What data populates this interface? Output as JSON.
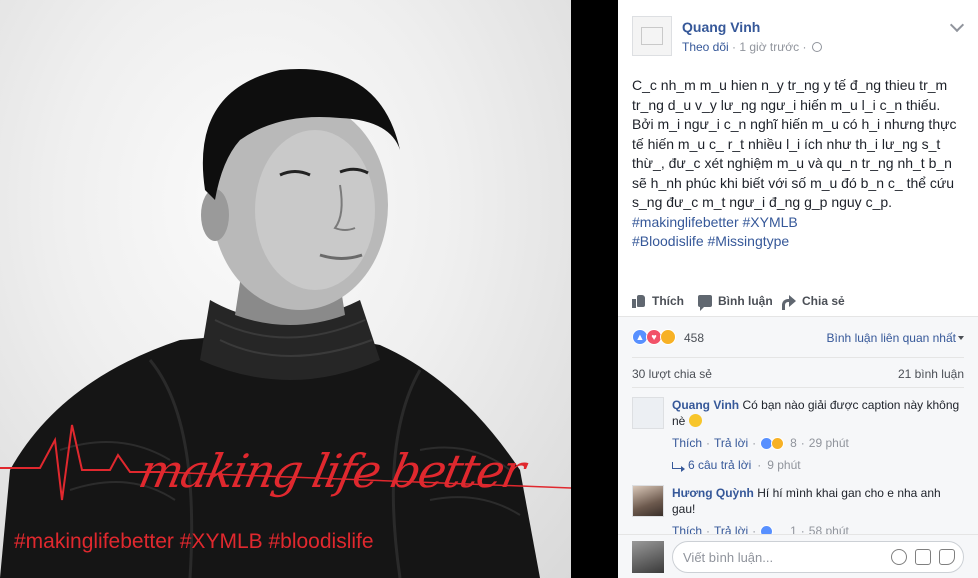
{
  "photo": {
    "overlay_script": "making life better",
    "overlay_tags": "#makinglifebetter #XYMLB #bloodislife",
    "accent_color": "#e0282e"
  },
  "post": {
    "author": "Quang Vinh",
    "follow_label": "Theo dõi",
    "meta_sep": " · ",
    "time": "1 giờ trước",
    "meta_sep2": " · ",
    "caption_lines": [
      "C_c nh_m m_u hien n_y tr_ng y tế đ_ng thieu tr_m tr_ng d_u v_y lư_ng ngư_i hiến m_u l_i c_n thiếu.",
      "Bởi m_i ngư_i c_n nghĩ hiến m_u có h_i nhưng thực tế hiến m_u c_ r_t nhiều l_i ích như th_i lư_ng s_t thừ_, đư_c xét nghiệm m_u và qu_n tr_ng nh_t b_n sẽ h_nh phúc khi biết với số m_u đó b_n c_ thể cứu s_ng đư_c m_t ngư_i đ_ng g_p nguy c_p."
    ],
    "hashtags_line1": [
      "#makinglifebetter",
      "#XYMLB"
    ],
    "hashtags_line2": [
      "#Bloodislife",
      "#Missingtype"
    ]
  },
  "actions": {
    "like": "Thích",
    "comment": "Bình luận",
    "share": "Chia sẻ"
  },
  "feedback": {
    "reaction_count": "458",
    "sort_label": "Bình luận liên quan nhất",
    "shares": "30 lượt chia sẻ",
    "comments_count": "21 bình luận"
  },
  "comments": [
    {
      "name": "Quang Vinh",
      "text": "Có bạn nào giải được caption này không nè",
      "like": "Thích",
      "reply": "Trả lời",
      "reaction_count": "8",
      "time": "29 phút",
      "replies_label": "6 câu trả lời",
      "replies_time": "9 phút"
    },
    {
      "name": "Hương Quỳnh",
      "text": "Hí hí mình khai gan cho e nha anh gau!",
      "like": "Thích",
      "reply": "Trả lời",
      "reaction_count": "1",
      "time": "58 phút"
    }
  ],
  "composer": {
    "placeholder": "Viết bình luận..."
  },
  "colors": {
    "link": "#365899",
    "muted": "#90949c",
    "text": "#1d2129",
    "feedback_bg": "#f6f7f9"
  }
}
